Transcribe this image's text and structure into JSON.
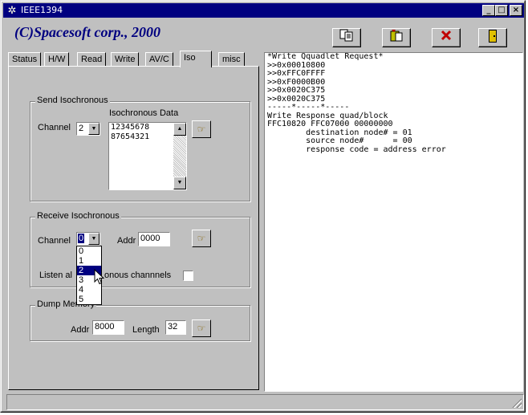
{
  "window": {
    "title": "IEEE1394",
    "controls": [
      "_",
      "□",
      "×"
    ]
  },
  "brand": "(C)Spacesoft corp., 2000",
  "toolbar": {
    "buttons": [
      "copy-icon",
      "paste-icon",
      "close-x-icon",
      "exit-door-icon"
    ]
  },
  "tabs": [
    "Status",
    "H/W",
    "Read",
    "Write",
    "AV/C",
    "Iso",
    "misc"
  ],
  "active_tab": "Iso",
  "send_iso": {
    "title": "Send Isochronous",
    "data_label": "Isochronous Data",
    "channel_label": "Channel",
    "channel_value": "2",
    "data_lines": [
      "12345678",
      "87654321"
    ]
  },
  "receive_iso": {
    "title": "Receive Isochronous",
    "channel_label": "Channel",
    "channel_value": "0",
    "addr_label": "Addr",
    "addr_value": "0000",
    "listen_label_pre": "Listen al",
    "listen_label_post": "onous channnels",
    "listen_checked": false,
    "dropdown_options": [
      "0",
      "1",
      "2",
      "3",
      "4",
      "5"
    ],
    "dropdown_highlight": "2"
  },
  "dump_memory": {
    "title": "Dump Memory",
    "addr_label": "Addr",
    "addr_value": "8000",
    "length_label": "Length",
    "length_value": "32"
  },
  "log_lines": [
    "*Write Qquadlet Request*",
    ">>0x00010800",
    ">>0xFFC0FFFF",
    ">>0xF0000B00",
    ">>0x0020C375",
    ">>0x0020C375",
    "-----*-----*-----",
    "Write Response quad/block",
    "FFC10820 FFC07000 00000000",
    "        destination node# = 01",
    "        source node#      = 00",
    "        response code = address error"
  ]
}
